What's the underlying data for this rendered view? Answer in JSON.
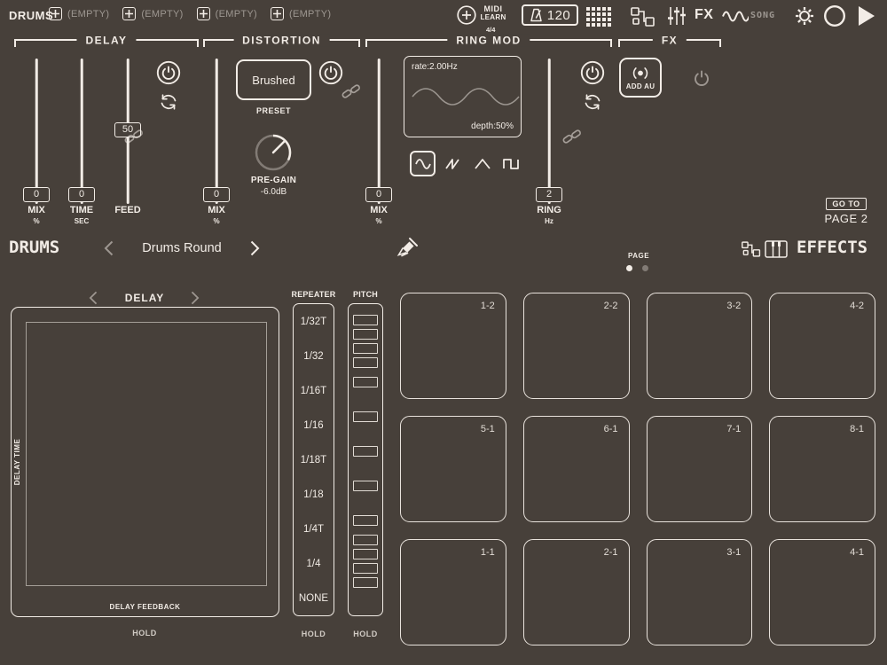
{
  "colors": {
    "bg": "#47403a",
    "fg": "#f2ece6"
  },
  "topbar": {
    "drums": "DRUMS",
    "slots": [
      "(EMPTY)",
      "(EMPTY)",
      "(EMPTY)",
      "(EMPTY)"
    ],
    "midi": "MIDI",
    "learn": "LEARN",
    "timesig": "4/4",
    "bpm": "120",
    "fx": "FX",
    "song": "SONG"
  },
  "fx_panel": {
    "delay": {
      "title": "DELAY",
      "mix_value": "0",
      "mix_label": "MIX",
      "mix_unit": "%",
      "time_value": "0",
      "time_label": "TIME",
      "time_unit": "SEC",
      "feed_value": "50",
      "feed_label": "FEED"
    },
    "distortion": {
      "title": "DISTORTION",
      "mix_value": "0",
      "mix_label": "MIX",
      "mix_unit": "%",
      "preset_value": "Brushed",
      "preset_label": "PRESET",
      "knob_label": "PRE-GAIN",
      "knob_value": "-6.0dB"
    },
    "ringmod": {
      "title": "RING MOD",
      "mix_value": "0",
      "mix_label": "MIX",
      "mix_unit": "%",
      "rate": "rate:2.00Hz",
      "depth": "depth:50%",
      "ring_value": "2",
      "ring_label": "RING",
      "ring_unit": "Hz"
    },
    "fx": {
      "title": "FX",
      "add_au": "ADD AU",
      "goto": "GO TO",
      "page2": "PAGE 2"
    }
  },
  "midbar": {
    "drums_logo": "DRUMS",
    "preset": "Drums Round",
    "page": "PAGE",
    "effects_logo": "EFFECTS"
  },
  "xypad": {
    "title": "DELAY",
    "y_axis": "DELAY TIME",
    "x_axis": "DELAY FEEDBACK",
    "hold": "HOLD"
  },
  "repeater": {
    "title": "REPEATER",
    "items": [
      "1/32T",
      "1/32",
      "1/16T",
      "1/16",
      "1/18T",
      "1/18",
      "1/4T",
      "1/4",
      "NONE"
    ],
    "hold": "HOLD"
  },
  "pitch": {
    "title": "PITCH",
    "hold": "HOLD"
  },
  "pads": {
    "labels": [
      "1-2",
      "2-2",
      "3-2",
      "4-2",
      "5-1",
      "6-1",
      "7-1",
      "8-1",
      "1-1",
      "2-1",
      "3-1",
      "4-1"
    ]
  }
}
